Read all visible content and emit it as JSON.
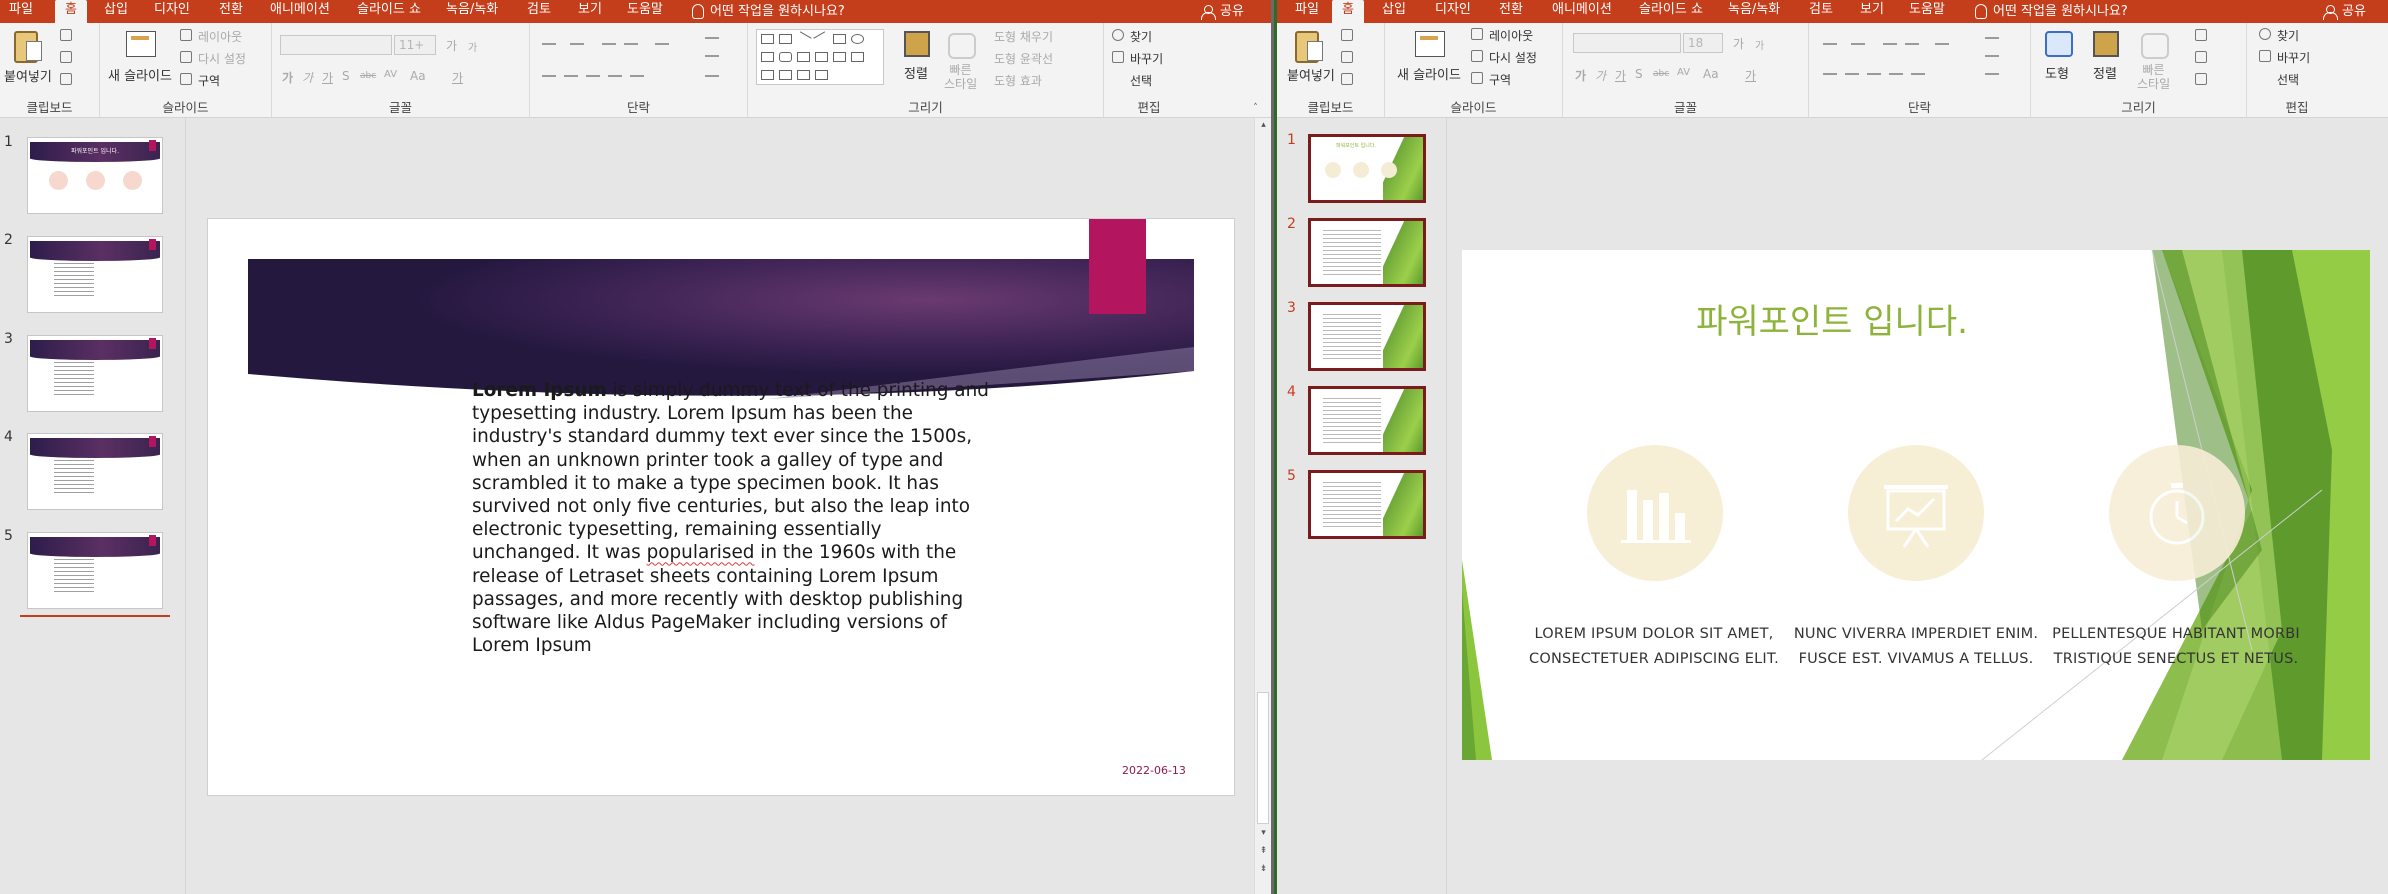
{
  "left_window": {
    "tabs": [
      "파일",
      "홈",
      "삽입",
      "디자인",
      "전환",
      "애니메이션",
      "슬라이드 쇼",
      "녹음/녹화",
      "검토",
      "보기",
      "도움말"
    ],
    "active_tab": "홈",
    "tell_me": "어떤 작업을 원하시나요?",
    "share": "공유",
    "ribbon": {
      "clipboard": {
        "paste": "붙여넣기",
        "label": "클립보드"
      },
      "slides": {
        "new_slide": "새 슬라이드",
        "layout": "레이아웃",
        "reset": "다시 설정",
        "section": "구역",
        "label": "슬라이드"
      },
      "font": {
        "label": "글꼴",
        "size_placeholder": "11+",
        "small": "가",
        "small2": "가",
        "bold": "가",
        "italic": "가",
        "underline": "가",
        "strike": "S",
        "abc": "abc",
        "spacing": "AV",
        "case": "Aa",
        "color": "가"
      },
      "paragraph": {
        "label": "단락"
      },
      "drawing": {
        "arrange": "정렬",
        "quick_styles": "빠른\n스타일",
        "fill": "도형 채우기",
        "outline": "도형 윤곽선",
        "effects": "도형 효과",
        "label": "그리기"
      },
      "editing": {
        "find": "찾기",
        "replace": "바꾸기",
        "select": "선택",
        "label": "편집"
      }
    },
    "thumbnails": [
      {
        "num": "1",
        "title": "파워포인트 입니다."
      },
      {
        "num": "2"
      },
      {
        "num": "3"
      },
      {
        "num": "4"
      },
      {
        "num": "5"
      }
    ],
    "slide": {
      "body_bold": "Lorem Ipsum",
      "body_rest_1": " is simply dummy text of the printing and typesetting industry. Lorem Ipsum has been the industry's standard dummy text ever since the 1500s, when an unknown printer took a galley of type and scrambled it to make a type specimen book. It has survived not only five centuries, but also the leap into electronic typesetting, remaining essentially unchanged. It was ",
      "body_misspelled": "popularised",
      "body_rest_2": " in the 1960s with the release of Letraset sheets containing Lorem Ipsum passages, and more recently with desktop publishing software like Aldus PageMaker including versions of Lorem Ipsum",
      "date": "2022-06-13"
    }
  },
  "right_window": {
    "tabs": [
      "파일",
      "홈",
      "삽입",
      "디자인",
      "전환",
      "애니메이션",
      "슬라이드 쇼",
      "녹음/녹화",
      "검토",
      "보기",
      "도움말"
    ],
    "active_tab": "홈",
    "tell_me": "어떤 작업을 원하시나요?",
    "share": "공유",
    "ribbon": {
      "clipboard": {
        "paste": "붙여넣기",
        "label": "클립보드"
      },
      "slides": {
        "new_slide": "새 슬라이드",
        "layout": "레이아웃",
        "reset": "다시 설정",
        "section": "구역",
        "label": "슬라이드"
      },
      "font": {
        "label": "글꼴",
        "size_value": "18",
        "small": "가",
        "small2": "가",
        "bold": "가",
        "italic": "가",
        "underline": "가",
        "strike": "S",
        "abc": "abc",
        "spacing": "AV",
        "case": "Aa",
        "color": "가"
      },
      "paragraph": {
        "label": "단락"
      },
      "drawing": {
        "shapes": "도형",
        "arrange": "정렬",
        "quick_styles": "빠른\n스타일",
        "label": "그리기"
      },
      "editing": {
        "find": "찾기",
        "replace": "바꾸기",
        "select": "선택",
        "label": "편집"
      }
    },
    "thumbnails": [
      "1",
      "2",
      "3",
      "4",
      "5"
    ],
    "slide": {
      "title": "파워포인트 입니다.",
      "columns": [
        {
          "icon": "bar-chart-icon",
          "line1": "LOREM IPSUM DOLOR SIT AMET,",
          "line2": "CONSECTETUER ADIPISCING ELIT."
        },
        {
          "icon": "presentation-board-icon",
          "line1": "NUNC VIVERRA IMPERDIET ENIM.",
          "line2": "FUSCE EST. VIVAMUS A TELLUS."
        },
        {
          "icon": "stopwatch-icon",
          "line1": "PELLENTESQUE HABITANT MORBI",
          "line2": "TRISTIQUE SENECTUS ET NETUS."
        }
      ]
    }
  },
  "colors": {
    "title_bar": "#c43e1c",
    "ribbon_bg": "#f3f3f3",
    "purple_band": "#3b2150",
    "magenta_accent": "#b3155f",
    "green_accent": "#8db33a",
    "icon_circle": "#f7eed6"
  }
}
